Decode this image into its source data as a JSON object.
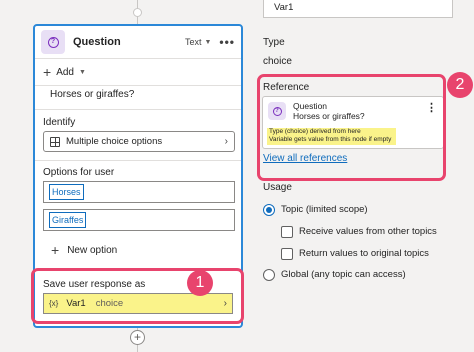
{
  "node": {
    "title": "Question",
    "type_label": "Text",
    "more": "•••",
    "add_label": "Add",
    "message": "Horses or giraffes?",
    "identify_label": "Identify",
    "identify_value": "Multiple choice options",
    "options_label": "Options for user",
    "options": [
      "Horses",
      "Giraffes"
    ],
    "new_option_label": "New option",
    "save_label": "Save user response as",
    "var_prefix": "{x}",
    "var_name": "Var1",
    "var_type": "choice"
  },
  "callouts": {
    "first": "1",
    "second": "2"
  },
  "panel": {
    "top_field": "Var1",
    "type_label": "Type",
    "type_value": "choice",
    "reference_label": "Reference",
    "ref_title": "Question",
    "ref_subtitle": "Horses or giraffes?",
    "ref_note_line1": "Type (choice) derived from here",
    "ref_note_line2": "Variable gets value from this node if empty",
    "view_all": "View all references",
    "usage_label": "Usage",
    "topic_scope": "Topic (limited scope)",
    "receive_values": "Receive values from other topics",
    "return_values": "Return values to original topics",
    "global_scope": "Global (any topic can access)"
  },
  "colors": {
    "accent": "#0f6cbd",
    "callout": "#e8446d",
    "highlight": "#faf38a",
    "node_border": "#2b88d8"
  },
  "icons": {
    "question": "question-bubble-icon",
    "grid": "grid-icon",
    "plus": "plus-icon",
    "chevron": "chevron-right-icon"
  }
}
